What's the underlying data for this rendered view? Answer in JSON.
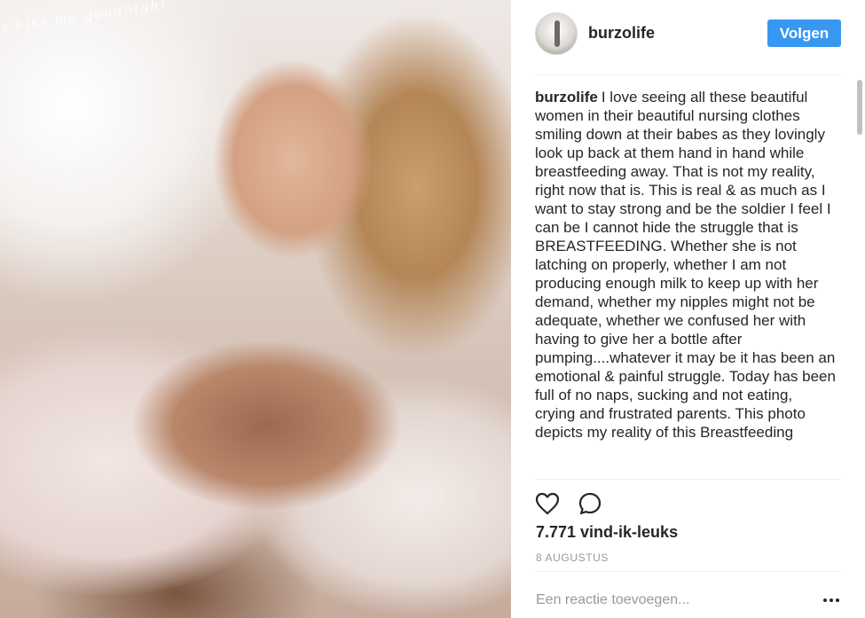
{
  "post": {
    "photo_watermark": "s kiss me goodnight",
    "author": {
      "username": "burzolife",
      "avatar_icon": "avatar-photo"
    },
    "follow_label": "Volgen",
    "caption": {
      "username": "burzolife",
      "text": "I love seeing all these beautiful women in their beautiful nursing clothes smiling down at their babes as they lovingly look up back at them hand in hand while breastfeeding away. That is not my reality, right now that is. This is real & as much as I want to stay strong and be the soldier I feel I can be I cannot hide the struggle that is BREASTFEEDING. Whether she is not latching on properly, whether I am not producing enough milk to keep up with her demand, whether my nipples might not be adequate, whether we confused her with having to give her a bottle after pumping....whatever it may be it has been an emotional & painful struggle. Today has been full of no naps, sucking and not eating, crying and frustrated parents. This photo depicts my reality of this Breastfeeding"
    },
    "actions": {
      "like_icon": "heart-icon",
      "comment_icon": "comment-bubble-icon"
    },
    "likes": "7.771 vind-ik-leuks",
    "date": "8 AUGUSTUS",
    "comment_placeholder": "Een reactie toevoegen...",
    "more_icon": "more-options-icon",
    "colors": {
      "accent": "#3897f0",
      "text": "#262626",
      "muted": "#999999",
      "divider": "#efefef"
    }
  }
}
